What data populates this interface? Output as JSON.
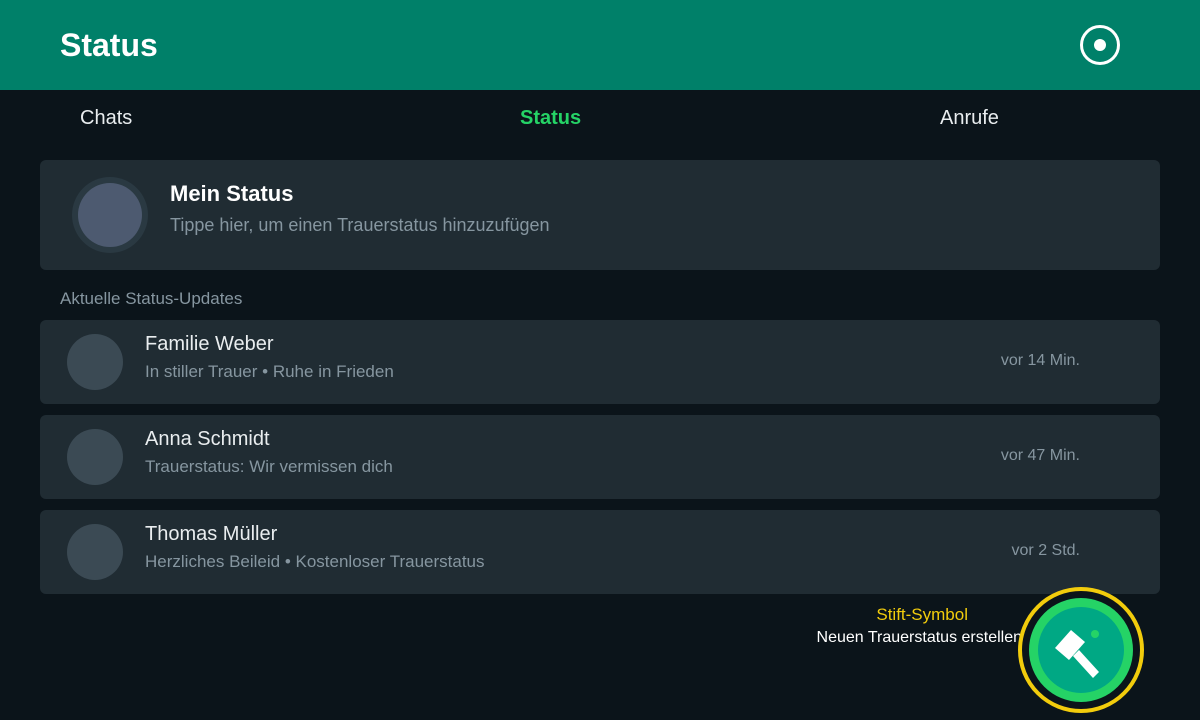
{
  "header": {
    "title": "Status",
    "camera_icon": "camera-icon"
  },
  "tabs": [
    {
      "label": "Chats",
      "active": false
    },
    {
      "label": "Status",
      "active": true
    },
    {
      "label": "Anrufe",
      "active": false
    }
  ],
  "my_status": {
    "name": "Mein Status",
    "hint": "Tippe hier, um einen Trauerstatus hinzuzufügen"
  },
  "section_label": "Aktuelle Status-Updates",
  "updates": [
    {
      "name": "Familie Weber",
      "subtitle": "In stiller Trauer • Ruhe in Frieden",
      "time": "vor 14 Min."
    },
    {
      "name": "Anna Schmidt",
      "subtitle": "Trauerstatus: Wir vermissen dich",
      "time": "vor 47 Min."
    },
    {
      "name": "Thomas Müller",
      "subtitle": "Herzliches Beileid • Kostenloser Trauerstatus",
      "time": "vor 2 Std."
    }
  ],
  "fab": {
    "hint_title": "Stift-Symbol",
    "hint_subtitle": "Neuen Trauerstatus erstellen",
    "icon": "pencil-icon"
  },
  "colors": {
    "header": "#008069",
    "background": "#0b141a",
    "card": "#202c33",
    "accent": "#25d366",
    "highlight": "#f2cc0c"
  }
}
